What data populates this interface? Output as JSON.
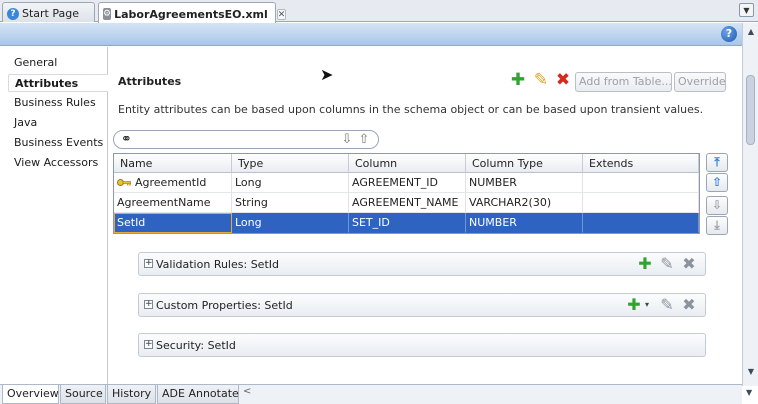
{
  "editor_tabs": [
    {
      "label": "Start Page"
    },
    {
      "label": "LaborAgreementsEO.xml"
    }
  ],
  "nav": {
    "items": [
      {
        "label": "General"
      },
      {
        "label": "Attributes"
      },
      {
        "label": "Business Rules"
      },
      {
        "label": "Java"
      },
      {
        "label": "Business Events"
      },
      {
        "label": "View Accessors"
      }
    ],
    "active": "Attributes"
  },
  "main": {
    "title": "Attributes",
    "description": "Entity attributes can be based upon columns in the schema object or can be based upon transient values.",
    "toolbar": {
      "add_from_table_label": "Add from Table...",
      "override_label": "Override"
    },
    "search": {
      "value": "",
      "placeholder": ""
    }
  },
  "table": {
    "columns": [
      "Name",
      "Type",
      "Column",
      "Column Type",
      "Extends"
    ],
    "rows": [
      {
        "name": "AgreementId",
        "type": "Long",
        "column": "AGREEMENT_ID",
        "column_type": "NUMBER",
        "extends": "",
        "key": true
      },
      {
        "name": "AgreementName",
        "type": "String",
        "column": "AGREEMENT_NAME",
        "column_type": "VARCHAR2(30)",
        "extends": "",
        "key": false
      },
      {
        "name": "SetId",
        "type": "Long",
        "column": "SET_ID",
        "column_type": "NUMBER",
        "extends": "",
        "key": false,
        "selected": true
      }
    ]
  },
  "panels": [
    {
      "title": "Validation Rules: SetId"
    },
    {
      "title": "Custom Properties: SetId"
    },
    {
      "title": "Security: SetId"
    }
  ],
  "bottom_tabs": [
    {
      "label": "Overview"
    },
    {
      "label": "Source"
    },
    {
      "label": "History"
    },
    {
      "label": "ADE Annotate"
    }
  ],
  "colors": {
    "selection": "#2f63c1",
    "header_band": "#a9c6e8",
    "add_icon": "#2ea52e",
    "delete_icon": "#d42a1e",
    "edit_icon": "#e0a21a"
  },
  "icons": {
    "start_page": "start-page-icon",
    "eo_file": "entity-object-icon",
    "help": "help-icon",
    "search": "binoculars-icon",
    "key": "primary-key-icon"
  }
}
